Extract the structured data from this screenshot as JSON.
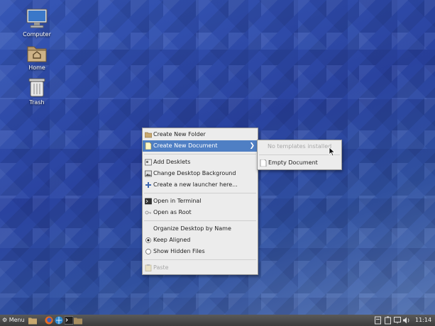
{
  "desktop": {
    "icons": [
      {
        "label": "Computer",
        "icon": "computer-icon"
      },
      {
        "label": "Home",
        "icon": "home-folder-icon"
      },
      {
        "label": "Trash",
        "icon": "trash-icon"
      }
    ]
  },
  "context_menu": {
    "items": [
      {
        "label": "Create New Folder",
        "icon": "folder-icon",
        "state": "normal"
      },
      {
        "label": "Create New Document",
        "icon": "document-icon",
        "state": "selected",
        "submenu": true
      },
      {
        "label": "Add Desklets",
        "icon": "desklet-icon",
        "state": "normal"
      },
      {
        "label": "Change Desktop Background",
        "icon": "image-icon",
        "state": "normal"
      },
      {
        "label": "Create a new launcher here...",
        "icon": "plus-icon",
        "state": "normal"
      },
      {
        "label": "Open in Terminal",
        "icon": "terminal-icon",
        "state": "normal"
      },
      {
        "label": "Open as Root",
        "icon": "key-icon",
        "state": "normal"
      },
      {
        "label": "Organize Desktop by Name",
        "icon": "",
        "state": "normal"
      },
      {
        "label": "Keep Aligned",
        "icon": "radio-checked-icon",
        "state": "checked"
      },
      {
        "label": "Show Hidden Files",
        "icon": "radio-unchecked-icon",
        "state": "normal"
      },
      {
        "label": "Paste",
        "icon": "paste-icon",
        "state": "disabled"
      }
    ]
  },
  "submenu": {
    "items": [
      {
        "label": "No templates installed",
        "state": "disabled"
      },
      {
        "label": "Empty Document",
        "icon": "document-icon",
        "state": "normal"
      }
    ]
  },
  "taskbar": {
    "menu_label": "Menu",
    "clock": "11:14",
    "launchers": [
      "folder-icon",
      "firefox-icon",
      "browser-icon",
      "terminal-icon",
      "files-icon"
    ],
    "tray": [
      "network-icon",
      "battery-icon",
      "display-icon",
      "volume-icon"
    ]
  },
  "colors": {
    "selection": "#4f7fc4",
    "menu_bg": "#ececec",
    "panel_bg": "#444444"
  }
}
